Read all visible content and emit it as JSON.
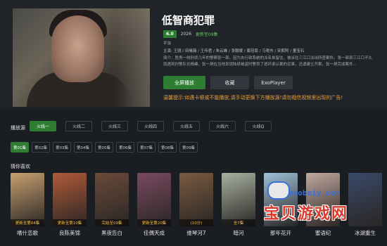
{
  "detail": {
    "title": "低智商犯罪",
    "rating": "6.0",
    "year": "2026",
    "status": "更新至09集",
    "genre": "平淡",
    "cast": "主演: 王骁 / 田曦薇 / 王传君 / 朱云峰 / 张翰瑷 / 姜冠南 / 马艳东 / 宋熙阿 / 董宝石",
    "intro": "简介：胜男一线刑侦几年的警察张一昂，因为去行政系统的派名单留住，被派往三江口派出所查案件。张一昂到三江口不久就遇到刑警队长杨峰，张一昂在当地发现陆续被盗时警员了逐环承认案的远事，迅速建立开案，张一昂完成案件..."
  },
  "buttons": {
    "play": "全屏播放",
    "fav": "收藏",
    "exo": "ExoPlayer"
  },
  "warning": "温馨提示:如遇卡顿或不能播放,请手动更换下方播放源!请勿相信视频里出现的广告!",
  "sources": {
    "label": "播放源",
    "items": [
      "火线一",
      "火线二",
      "火线三",
      "火线四",
      "火线五",
      "火线六",
      "火线Q"
    ],
    "active_index": 0
  },
  "episodes": {
    "items": [
      "第01集",
      "第02集",
      "第03集",
      "第04集",
      "第05集",
      "第06集",
      "第07集",
      "第08集",
      "第09集"
    ],
    "active_index": 0
  },
  "recommend": {
    "title": "猜你喜欢",
    "items": [
      {
        "name": "嗜什恋歌",
        "badge": "更新至第04集",
        "color": "#c8a070"
      },
      {
        "name": "良陈美锦",
        "badge": "更新至第10集",
        "color": "#b05a3a"
      },
      {
        "name": "黑夜告白",
        "badge": "完结至09集",
        "color": "#6a4a3a"
      },
      {
        "name": "佳偶天成",
        "badge": "更新至第20集",
        "color": "#7a4a60"
      },
      {
        "name": "维琴河7",
        "badge": "(10分)",
        "color": "#7a5a40"
      },
      {
        "name": "暗河",
        "badge": "全7集",
        "color": "#a8b0a0"
      },
      {
        "name": "那年花开",
        "badge": "",
        "color": "#9ec0d8"
      },
      {
        "name": "蜜语纪",
        "badge": "",
        "color": "#c0a8a0"
      },
      {
        "name": "冰湖重生",
        "badge": "",
        "color": "#3a4a6a"
      }
    ]
  },
  "watermark": {
    "url": "baobeiy.com",
    "text": "宝贝游戏网"
  }
}
